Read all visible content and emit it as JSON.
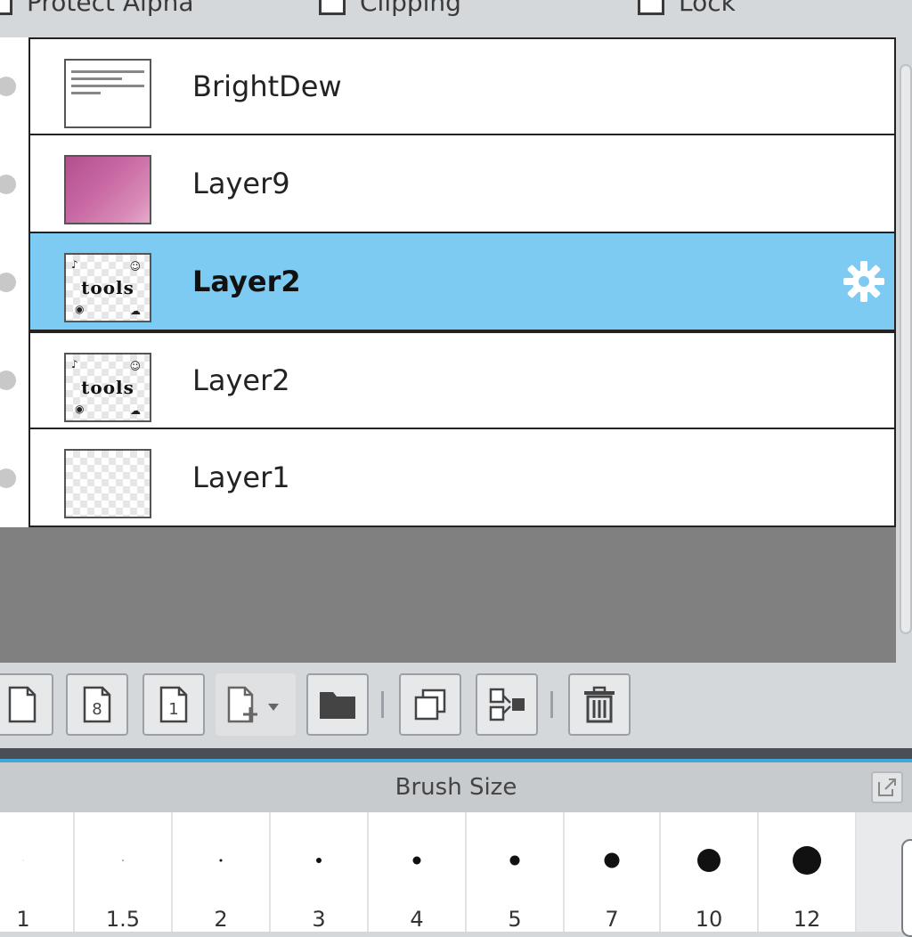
{
  "options": {
    "protect_alpha": {
      "label": "Protect Alpha",
      "checked": false
    },
    "clipping": {
      "label": "Clipping",
      "checked": false
    },
    "lock": {
      "label": "Lock",
      "checked": false
    }
  },
  "layers": [
    {
      "name": "BrightDew",
      "thumbnail": "text-lines",
      "selected": false
    },
    {
      "name": "Layer9",
      "thumbnail": "pink-paint",
      "selected": false
    },
    {
      "name": "Layer2",
      "thumbnail": "tools-sketch",
      "thumb_text": "tools",
      "selected": true
    },
    {
      "name": "Layer2",
      "thumbnail": "tools-sketch",
      "thumb_text": "tools",
      "selected": false
    },
    {
      "name": "Layer1",
      "thumbnail": "transparent",
      "selected": false
    }
  ],
  "selected_layer_icon": "gear-icon",
  "toolbar": {
    "buttons": [
      {
        "icon": "new-layer-icon"
      },
      {
        "icon": "new-8bit-layer-icon",
        "glyph": "8"
      },
      {
        "icon": "new-1bit-layer-icon",
        "glyph": "1"
      },
      {
        "icon": "add-layer-dropdown-icon"
      },
      {
        "icon": "folder-icon"
      },
      {
        "icon": "duplicate-layer-icon"
      },
      {
        "icon": "merge-layer-icon"
      },
      {
        "icon": "trash-icon"
      }
    ]
  },
  "brush_panel": {
    "title": "Brush Size",
    "popout_icon": "popout-icon",
    "sizes": [
      "1",
      "1.5",
      "2",
      "3",
      "4",
      "5",
      "7",
      "10",
      "12"
    ]
  },
  "colors": {
    "selected_row": "#7dcbf3",
    "accent_line": "#3fa7d9",
    "empty_area": "#808080"
  }
}
